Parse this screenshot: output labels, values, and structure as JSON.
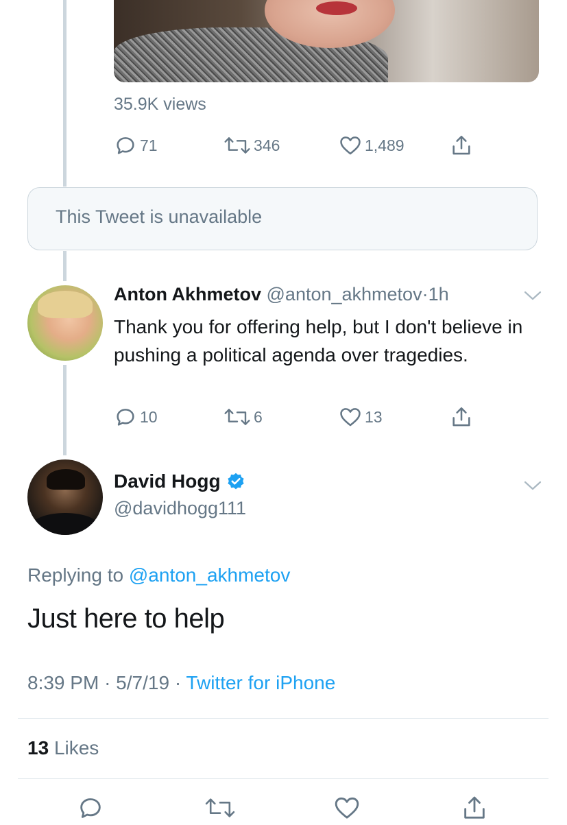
{
  "quoted_tweet": {
    "views": "35.9K views",
    "reply_count": "71",
    "retweet_count": "346",
    "like_count": "1,489"
  },
  "unavailable": {
    "text": "This Tweet is unavailable"
  },
  "reply_tweet": {
    "name": "Anton Akhmetov",
    "handle": "@anton_akhmetov",
    "separator": "·",
    "time": "1h",
    "text": "Thank you for offering help, but I don't believe in pushing a political agenda over tragedies.",
    "reply_count": "10",
    "retweet_count": "6",
    "like_count": "13"
  },
  "main_tweet": {
    "name": "David Hogg",
    "verified": true,
    "handle": "@davidhogg111",
    "replying_prefix": "Replying to",
    "replying_to": "@anton_akhmetov",
    "text": "Just here to help",
    "time": "8:39 PM",
    "date": "5/7/19",
    "separator": "·",
    "client": "Twitter for iPhone",
    "likes_count": "13",
    "likes_label": "Likes"
  },
  "icons": {
    "reply": "reply-icon",
    "retweet": "retweet-icon",
    "like": "heart-icon",
    "share": "share-icon",
    "verified": "verified-badge-icon",
    "menu": "chevron-down-icon"
  },
  "colors": {
    "accent": "#1da1f2",
    "secondary_text": "#657786",
    "primary_text": "#14171a",
    "thread_line": "#ccd6dd"
  }
}
